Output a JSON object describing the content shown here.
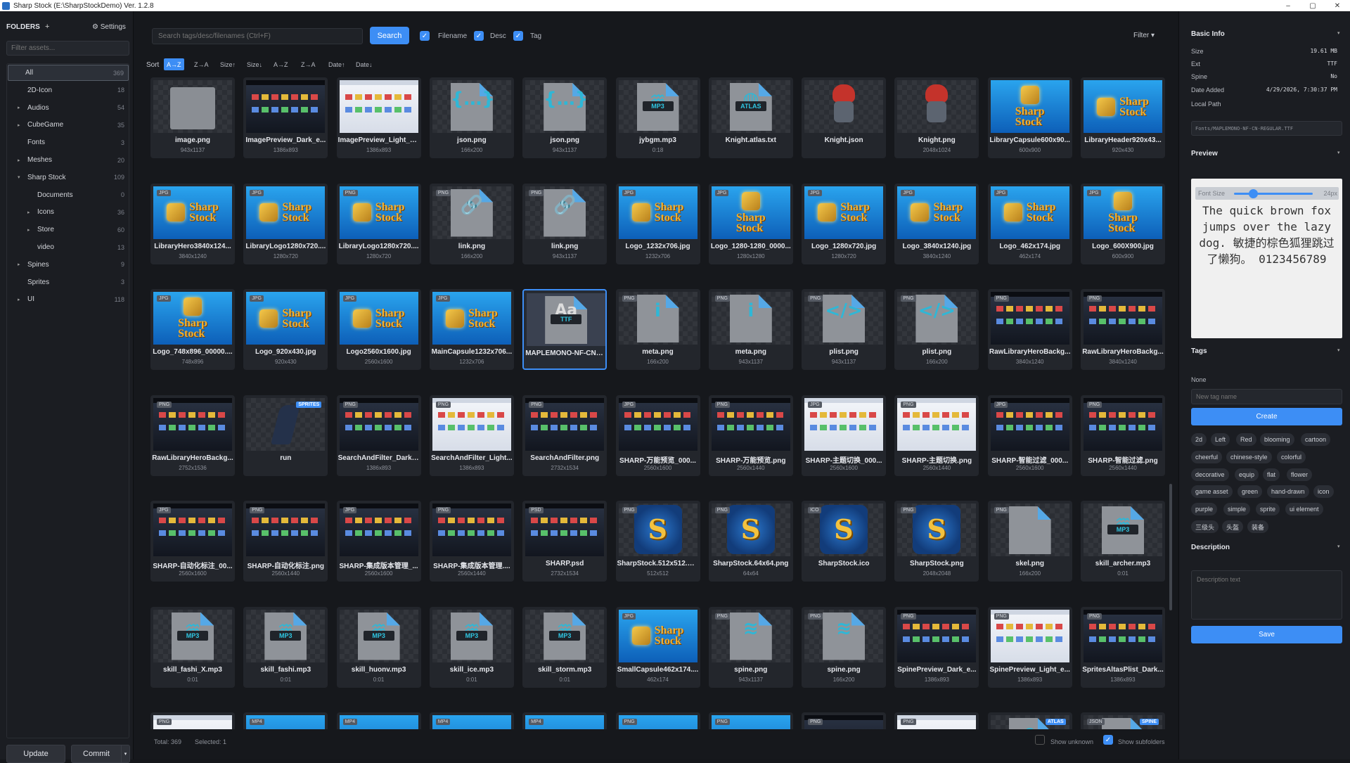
{
  "window": {
    "title": "Sharp Stock (E:\\SharpStockDemo) Ver. 1.2.8",
    "minimize": "–",
    "maximize": "▢",
    "close": "✕"
  },
  "sidebar": {
    "title": "FOLDERS",
    "add": "+",
    "settings": "⚙ Settings",
    "filter_placeholder": "Filter assets...",
    "items": [
      {
        "label": "All",
        "count": "369",
        "depth": 0,
        "caret": "",
        "selected": true
      },
      {
        "label": "2D-Icon",
        "count": "18",
        "depth": 1,
        "caret": ""
      },
      {
        "label": "Audios",
        "count": "54",
        "depth": 1,
        "caret": "▸"
      },
      {
        "label": "CubeGame",
        "count": "35",
        "depth": 1,
        "caret": "▸"
      },
      {
        "label": "Fonts",
        "count": "3",
        "depth": 1,
        "caret": ""
      },
      {
        "label": "Meshes",
        "count": "20",
        "depth": 1,
        "caret": "▸"
      },
      {
        "label": "Sharp Stock",
        "count": "109",
        "depth": 1,
        "caret": "▾"
      },
      {
        "label": "Documents",
        "count": "0",
        "depth": 2,
        "caret": ""
      },
      {
        "label": "Icons",
        "count": "36",
        "depth": 2,
        "caret": "▸"
      },
      {
        "label": "Store",
        "count": "60",
        "depth": 2,
        "caret": "▸"
      },
      {
        "label": "video",
        "count": "13",
        "depth": 2,
        "caret": ""
      },
      {
        "label": "Spines",
        "count": "9",
        "depth": 1,
        "caret": "▸"
      },
      {
        "label": "Sprites",
        "count": "3",
        "depth": 1,
        "caret": ""
      },
      {
        "label": "UI",
        "count": "118",
        "depth": 1,
        "caret": "▸"
      }
    ],
    "update": "Update",
    "commit": "Commit",
    "commit_arrow": "▾"
  },
  "toolbar": {
    "search_placeholder": "Search tags/desc/filenames (Ctrl+F)",
    "search": "Search",
    "check": "✓",
    "filename": "Filename",
    "desc": "Desc",
    "tag": "Tag",
    "filter": "Filter ▾",
    "sort_label": "Sort",
    "sorts": [
      "A→Z",
      "Z→A",
      "Size↑",
      "Size↓",
      "A→Z",
      "Z→A",
      "Date↑",
      "Date↓"
    ]
  },
  "assets": [
    {
      "name": "image.png",
      "sub": "943x1137",
      "thumb": "gray"
    },
    {
      "name": "ImagePreview_Dark_e...",
      "sub": "1386x893",
      "thumb": "shot-dark"
    },
    {
      "name": "ImagePreview_Light_e...",
      "sub": "1386x893",
      "thumb": "shot-light"
    },
    {
      "name": "json.png",
      "sub": "166x200",
      "thumb": "file",
      "glyph": "{…}"
    },
    {
      "name": "json.png",
      "sub": "943x1137",
      "thumb": "file",
      "glyph": "{…}"
    },
    {
      "name": "jybgm.mp3",
      "sub": "0:18",
      "thumb": "file",
      "glyph": "♒",
      "tag": "MP3"
    },
    {
      "name": "Knight.atlas.txt",
      "sub": "",
      "thumb": "file",
      "glyph": "◍",
      "tag": "ATLAS"
    },
    {
      "name": "Knight.json",
      "sub": "",
      "thumb": "knight"
    },
    {
      "name": "Knight.png",
      "sub": "2048x1024",
      "thumb": "knight"
    },
    {
      "name": "LibraryCapsule600x90...",
      "sub": "600x900",
      "thumb": "logo-tall"
    },
    {
      "name": "LibraryHeader920x43...",
      "sub": "920x430",
      "thumb": "logo"
    },
    {
      "name": "LibraryHero3840x124...",
      "sub": "3840x1240",
      "thumb": "logo",
      "badge": "JPG"
    },
    {
      "name": "LibraryLogo1280x720....",
      "sub": "1280x720",
      "thumb": "logo",
      "badge": "JPG"
    },
    {
      "name": "LibraryLogo1280x720....",
      "sub": "1280x720",
      "thumb": "logo",
      "badge": "PNG"
    },
    {
      "name": "link.png",
      "sub": "166x200",
      "thumb": "file",
      "glyph": "🔗",
      "badge": "PNG"
    },
    {
      "name": "link.png",
      "sub": "943x1137",
      "thumb": "file",
      "glyph": "🔗",
      "badge": "PNG"
    },
    {
      "name": "Logo_1232x706.jpg",
      "sub": "1232x706",
      "thumb": "logo",
      "badge": "JPG"
    },
    {
      "name": "Logo_1280-1280_0000...",
      "sub": "1280x1280",
      "thumb": "logo-tall",
      "badge": "JPG"
    },
    {
      "name": "Logo_1280x720.jpg",
      "sub": "1280x720",
      "thumb": "logo",
      "badge": "JPG"
    },
    {
      "name": "Logo_3840x1240.jpg",
      "sub": "3840x1240",
      "thumb": "logo",
      "badge": "JPG"
    },
    {
      "name": "Logo_462x174.jpg",
      "sub": "462x174",
      "thumb": "logo",
      "badge": "JPG"
    },
    {
      "name": "Logo_600X900.jpg",
      "sub": "600x900",
      "thumb": "logo-tall",
      "badge": "JPG"
    },
    {
      "name": "Logo_748x896_00000....",
      "sub": "748x896",
      "thumb": "logo-tall",
      "badge": "JPG"
    },
    {
      "name": "Logo_920x430.jpg",
      "sub": "920x430",
      "thumb": "logo",
      "badge": "JPG"
    },
    {
      "name": "Logo2560x1600.jpg",
      "sub": "2560x1600",
      "thumb": "logo",
      "badge": "JPG"
    },
    {
      "name": "MainCapsule1232x706...",
      "sub": "1232x706",
      "thumb": "logo",
      "badge": "JPG"
    },
    {
      "name": "MAPLEMONO-NF-CN-...",
      "sub": "",
      "thumb": "font",
      "selected": true
    },
    {
      "name": "meta.png",
      "sub": "166x200",
      "thumb": "file",
      "glyph": "i",
      "badge": "PNG"
    },
    {
      "name": "meta.png",
      "sub": "943x1137",
      "thumb": "file",
      "glyph": "i",
      "badge": "PNG"
    },
    {
      "name": "plist.png",
      "sub": "943x1137",
      "thumb": "file",
      "glyph": "</>",
      "badge": "PNG"
    },
    {
      "name": "plist.png",
      "sub": "166x200",
      "thumb": "file",
      "glyph": "</>",
      "badge": "PNG"
    },
    {
      "name": "RawLibraryHeroBackg...",
      "sub": "3840x1240",
      "thumb": "shot-dark",
      "badge": "PNG"
    },
    {
      "name": "RawLibraryHeroBackg...",
      "sub": "3840x1240",
      "thumb": "shot-dark",
      "badge": "PNG"
    },
    {
      "name": "RawLibraryHeroBackg...",
      "sub": "2752x1536",
      "thumb": "shot-dark",
      "badge": "PNG"
    },
    {
      "name": "run",
      "sub": "",
      "thumb": "run",
      "spr": "SPRITES"
    },
    {
      "name": "SearchAndFilter_Dark_...",
      "sub": "1386x893",
      "thumb": "shot-dark",
      "badge": "PNG"
    },
    {
      "name": "SearchAndFilter_Light...",
      "sub": "1386x893",
      "thumb": "shot-light",
      "badge": "PNG"
    },
    {
      "name": "SearchAndFilter.png",
      "sub": "2732x1534",
      "thumb": "shot-dark",
      "badge": "PNG"
    },
    {
      "name": "SHARP-万能预览_000...",
      "sub": "2560x1600",
      "thumb": "shot-dark",
      "badge": "JPG"
    },
    {
      "name": "SHARP-万能预览.png",
      "sub": "2560x1440",
      "thumb": "shot-dark",
      "badge": "PNG"
    },
    {
      "name": "SHARP-主题切换_000...",
      "sub": "2560x1600",
      "thumb": "shot-light",
      "badge": "JPG"
    },
    {
      "name": "SHARP-主题切换.png",
      "sub": "2560x1440",
      "thumb": "shot-light",
      "badge": "PNG"
    },
    {
      "name": "SHARP-智能过滤_000...",
      "sub": "2560x1600",
      "thumb": "shot-dark",
      "badge": "JPG"
    },
    {
      "name": "SHARP-智能过滤.png",
      "sub": "2560x1440",
      "thumb": "shot-dark",
      "badge": "PNG"
    },
    {
      "name": "SHARP-自动化标注_00...",
      "sub": "2560x1600",
      "thumb": "shot-dark",
      "badge": "JPG"
    },
    {
      "name": "SHARP-自动化标注.png",
      "sub": "2560x1440",
      "thumb": "shot-dark",
      "badge": "PNG"
    },
    {
      "name": "SHARP-集成版本管理_...",
      "sub": "2560x1600",
      "thumb": "shot-dark",
      "badge": "JPG"
    },
    {
      "name": "SHARP-集成版本管理....",
      "sub": "2560x1440",
      "thumb": "shot-dark",
      "badge": "PNG"
    },
    {
      "name": "SHARP.psd",
      "sub": "2732x1534",
      "thumb": "shot-dark",
      "badge": "PSD"
    },
    {
      "name": "SharpStock.512x512.png",
      "sub": "512x512",
      "thumb": "safe",
      "badge": "PNG"
    },
    {
      "name": "SharpStock.64x64.png",
      "sub": "64x64",
      "thumb": "safe",
      "badge": "PNG"
    },
    {
      "name": "SharpStock.ico",
      "sub": "",
      "thumb": "safe",
      "badge": "ICO"
    },
    {
      "name": "SharpStock.png",
      "sub": "2048x2048",
      "thumb": "safe",
      "badge": "PNG"
    },
    {
      "name": "skel.png",
      "sub": "166x200",
      "thumb": "file",
      "glyph": "",
      "badge": "PNG"
    },
    {
      "name": "skill_archer.mp3",
      "sub": "0:01",
      "thumb": "file",
      "glyph": "♒",
      "tag": "MP3"
    },
    {
      "name": "skill_fashi_X.mp3",
      "sub": "0:01",
      "thumb": "file",
      "glyph": "♒",
      "tag": "MP3"
    },
    {
      "name": "skill_fashi.mp3",
      "sub": "0:01",
      "thumb": "file",
      "glyph": "♒",
      "tag": "MP3"
    },
    {
      "name": "skill_huonv.mp3",
      "sub": "0:01",
      "thumb": "file",
      "glyph": "♒",
      "tag": "MP3"
    },
    {
      "name": "skill_ice.mp3",
      "sub": "0:01",
      "thumb": "file",
      "glyph": "♒",
      "tag": "MP3"
    },
    {
      "name": "skill_storm.mp3",
      "sub": "0:01",
      "thumb": "file",
      "glyph": "♒",
      "tag": "MP3"
    },
    {
      "name": "SmallCapsule462x174....",
      "sub": "462x174",
      "thumb": "logo",
      "badge": "JPG"
    },
    {
      "name": "spine.png",
      "sub": "943x1137",
      "thumb": "file",
      "glyph": "≋",
      "badge": "PNG"
    },
    {
      "name": "spine.png",
      "sub": "166x200",
      "thumb": "file",
      "glyph": "≋",
      "badge": "PNG"
    },
    {
      "name": "SpinePreview_Dark_e...",
      "sub": "1386x893",
      "thumb": "shot-dark",
      "badge": "PNG"
    },
    {
      "name": "SpinePreview_Light_e...",
      "sub": "1386x893",
      "thumb": "shot-light",
      "badge": "PNG"
    },
    {
      "name": "SpritesAltasPlist_Dark...",
      "sub": "1386x893",
      "thumb": "shot-dark",
      "badge": "PNG"
    },
    {
      "name": "",
      "sub": "",
      "thumb": "shot-light",
      "badge": "PNG"
    },
    {
      "name": "",
      "sub": "",
      "thumb": "logo",
      "badge": "MP4"
    },
    {
      "name": "",
      "sub": "",
      "thumb": "logo",
      "badge": "MP4"
    },
    {
      "name": "",
      "sub": "",
      "thumb": "logo",
      "badge": "MP4"
    },
    {
      "name": "",
      "sub": "",
      "thumb": "logo",
      "badge": "MP4"
    },
    {
      "name": "",
      "sub": "",
      "thumb": "logo",
      "badge": "PNG"
    },
    {
      "name": "",
      "sub": "",
      "thumb": "logo",
      "badge": "PNG"
    },
    {
      "name": "",
      "sub": "",
      "thumb": "shot-dark",
      "badge": "PNG"
    },
    {
      "name": "",
      "sub": "",
      "thumb": "shot-light",
      "badge": "PNG"
    },
    {
      "name": "",
      "sub": "",
      "thumb": "file",
      "glyph": "◍",
      "spr": "ATLAS"
    },
    {
      "name": "",
      "sub": "",
      "thumb": "file",
      "glyph": "",
      "spr": "SPINE",
      "badge": "JSON"
    }
  ],
  "footer": {
    "total": "Total: 369",
    "selected": "Selected: 1",
    "show_unknown": "Show unknown",
    "show_subfolders": "Show subfolders"
  },
  "info": {
    "title": "Basic Info",
    "arrow": "▾",
    "rows": [
      {
        "k": "Size",
        "v": "19.61 MB"
      },
      {
        "k": "Ext",
        "v": "TTF"
      },
      {
        "k": "Spine",
        "v": "No"
      },
      {
        "k": "Date Added",
        "v": "4/29/2026, 7:30:37 PM"
      }
    ],
    "local_path_label": "Local Path",
    "local_path": "Fonts/MAPLEMONO-NF-CN-REGULAR.TTF"
  },
  "preview": {
    "title": "Preview",
    "font_size_label": "Font Size",
    "font_size_value": "24px",
    "font_size_fraction": 0.24,
    "text": "The quick brown fox jumps over the lazy dog. 敏捷的棕色狐狸跳过了懒狗。 0123456789"
  },
  "tags": {
    "title": "Tags",
    "none": "None",
    "new_placeholder": "New tag name",
    "create": "Create",
    "list": [
      "2d",
      "Left",
      "Red",
      "blooming",
      "cartoon",
      "cheerful",
      "chinese-style",
      "colorful",
      "decorative",
      "equip",
      "flat",
      "flower",
      "game asset",
      "green",
      "hand-drawn",
      "icon",
      "purple",
      "simple",
      "sprite",
      "ui element",
      "三级头",
      "头盔",
      "装备"
    ]
  },
  "description": {
    "title": "Description",
    "placeholder": "Description text",
    "save": "Save"
  },
  "colors": {
    "accent": "#3d8ef5",
    "bg": "#15171b",
    "panel": "#1b1d22"
  }
}
